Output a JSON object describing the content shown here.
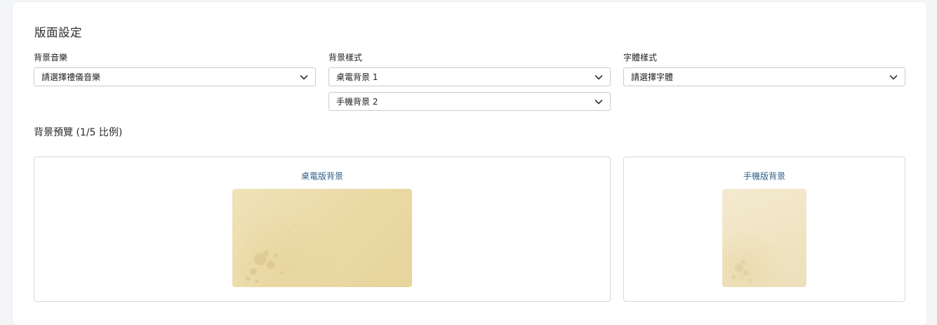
{
  "page": {
    "title": "版面設定"
  },
  "fields": {
    "music": {
      "label": "背景音樂",
      "selected": "請選擇禮儀音樂"
    },
    "background": {
      "label": "背景樣式",
      "desktop_selected": "桌電背景 1",
      "mobile_selected": "手機背景 2"
    },
    "font": {
      "label": "字體樣式",
      "selected": "請選擇字體"
    }
  },
  "preview": {
    "title": "背景預覽 (1/5 比例)",
    "desktop_label": "桌電版背景",
    "mobile_label": "手機版背景"
  },
  "colors": {
    "label_link": "#2f5f8a",
    "border": "#c9ccd1"
  },
  "icons": {
    "dropdown": "chevron-down-icon"
  }
}
